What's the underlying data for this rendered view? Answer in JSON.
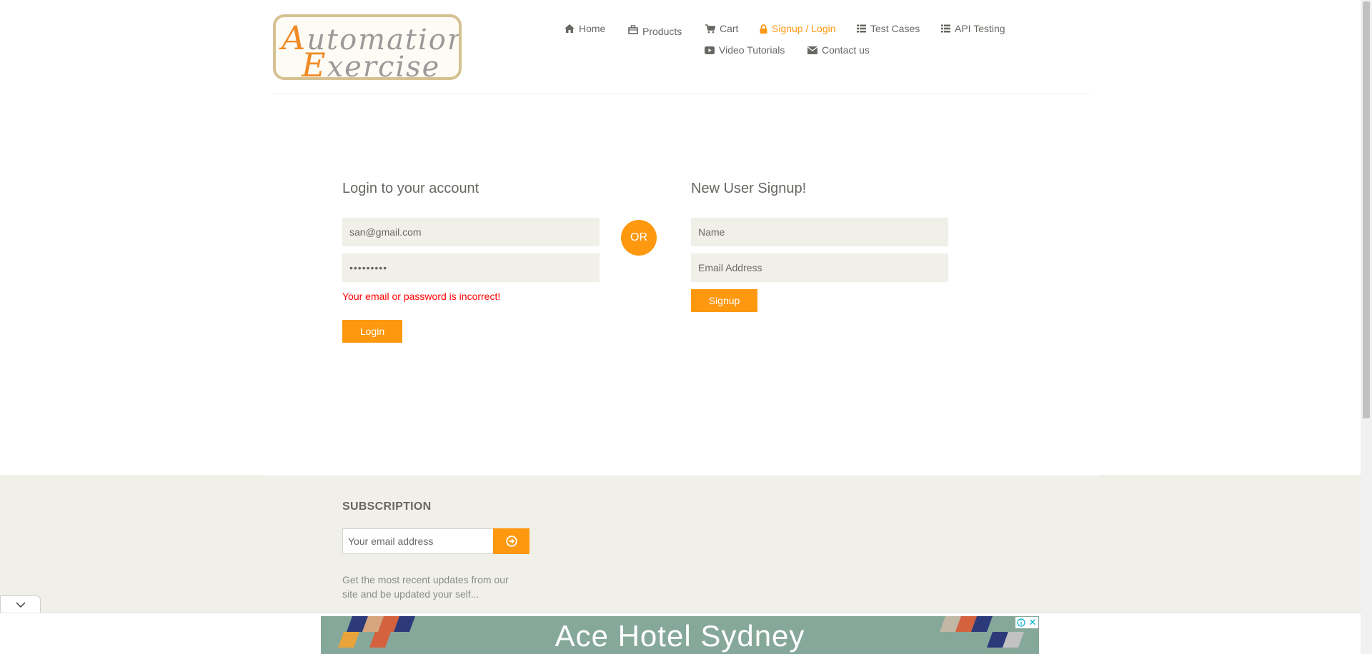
{
  "brand": {
    "logo_line1_cap": "A",
    "logo_line1_rest": "utomation",
    "logo_line2_cap": "E",
    "logo_line2_rest": "xercise",
    "accent_color": "#fe980f"
  },
  "nav": {
    "items": [
      {
        "label": "Home",
        "icon": "home-icon"
      },
      {
        "label": "Products",
        "icon": "products-icon"
      },
      {
        "label": "Cart",
        "icon": "cart-icon"
      },
      {
        "label": "Signup / Login",
        "icon": "lock-icon",
        "active": true
      },
      {
        "label": "Test Cases",
        "icon": "list-icon"
      },
      {
        "label": "API Testing",
        "icon": "list-icon"
      },
      {
        "label": "Video Tutorials",
        "icon": "youtube-icon"
      },
      {
        "label": "Contact us",
        "icon": "envelope-icon"
      }
    ]
  },
  "login": {
    "title": "Login to your account",
    "email_value": "san@gmail.com",
    "password_value": "•••••••••",
    "error": "Your email or password is incorrect!",
    "button": "Login"
  },
  "divider": {
    "or_label": "OR"
  },
  "signup": {
    "title": "New User Signup!",
    "name_placeholder": "Name",
    "email_placeholder": "Email Address",
    "button": "Signup"
  },
  "footer": {
    "subscription_title": "SUBSCRIPTION",
    "email_placeholder": "Your email address",
    "subscription_text": "Get the most recent updates from our site and be updated your self..."
  },
  "ad": {
    "text": "Ace Hotel Sydney",
    "close_label": "✕",
    "info_label": "ⓘ"
  }
}
